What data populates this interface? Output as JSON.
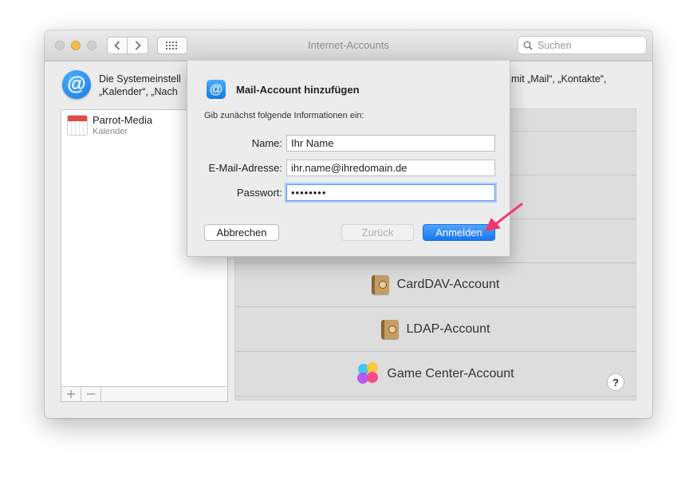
{
  "window": {
    "title": "Internet-Accounts",
    "search_placeholder": "Suchen"
  },
  "header": {
    "text_left": "Die Systemeinstell",
    "text_left_line2": "„Kalender“, „Nach",
    "text_right": "mit „Mail“, „Kontakte“,"
  },
  "accounts": [
    {
      "name": "Parrot-Media",
      "type": "Kalender",
      "icon": "calendar-icon"
    }
  ],
  "providers": [
    {
      "label": "CardDAV-Account",
      "icon": "address-book-icon"
    },
    {
      "label": "LDAP-Account",
      "icon": "address-book-icon"
    },
    {
      "label": "Game Center-Account",
      "icon": "game-center-icon"
    }
  ],
  "dialog": {
    "title": "Mail-Account hinzufügen",
    "subtitle": "Gib zunächst folgende Informationen ein:",
    "name_label": "Name:",
    "name_value": "Ihr Name",
    "email_label": "E-Mail-Adresse:",
    "email_value": "ihr.name@ihredomain.de",
    "password_label": "Passwort:",
    "password_value": "••••••••",
    "cancel_label": "Abbrechen",
    "back_label": "Zurück",
    "login_label": "Anmelden"
  },
  "colors": {
    "accent": "#1877f2",
    "arrow": "#f0386b"
  }
}
